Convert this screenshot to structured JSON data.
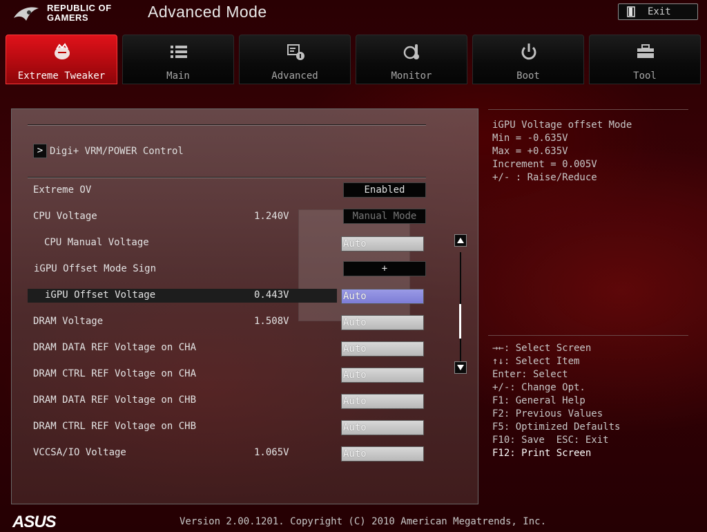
{
  "header": {
    "brand_line1": "REPUBLIC OF",
    "brand_line2": "GAMERS",
    "title": "Advanced Mode",
    "exit_label": "Exit"
  },
  "tabs": [
    {
      "label": "Extreme Tweaker",
      "icon": "extreme-tweaker-icon",
      "active": true
    },
    {
      "label": "Main",
      "icon": "list-icon",
      "active": false
    },
    {
      "label": "Advanced",
      "icon": "settings-monitor-icon",
      "active": false
    },
    {
      "label": "Monitor",
      "icon": "thermometer-icon",
      "active": false
    },
    {
      "label": "Boot",
      "icon": "power-icon",
      "active": false
    },
    {
      "label": "Tool",
      "icon": "toolbox-icon",
      "active": false
    }
  ],
  "submenu": {
    "label": "Digi+ VRM/POWER Control"
  },
  "settings": [
    {
      "label": "Extreme OV",
      "value": "",
      "control": "Enabled"
    },
    {
      "label": "CPU Voltage",
      "value": "1.240V",
      "control": "Manual Mode"
    },
    {
      "label": "CPU Manual Voltage",
      "value": "",
      "control": "Auto"
    },
    {
      "label": "iGPU Offset Mode Sign",
      "value": "",
      "control": "+"
    },
    {
      "label": "iGPU Offset Voltage",
      "value": "0.443V",
      "control": "Auto"
    },
    {
      "label": "DRAM Voltage",
      "value": "1.508V",
      "control": "Auto"
    },
    {
      "label": "DRAM DATA REF Voltage on CHA",
      "value": "",
      "control": "Auto"
    },
    {
      "label": "DRAM CTRL REF Voltage on CHA",
      "value": "",
      "control": "Auto"
    },
    {
      "label": "DRAM DATA REF Voltage on CHB",
      "value": "",
      "control": "Auto"
    },
    {
      "label": "DRAM CTRL REF Voltage on CHB",
      "value": "",
      "control": "Auto"
    },
    {
      "label": "VCCSA/IO Voltage",
      "value": "1.065V",
      "control": "Auto"
    }
  ],
  "help": {
    "lines": [
      "iGPU Voltage offset Mode",
      "Min = -0.635V",
      "Max = +0.635V",
      "Increment = 0.005V",
      "+/- : Raise/Reduce"
    ],
    "keys": [
      "→←: Select Screen",
      "↑↓: Select Item",
      "Enter: Select",
      "+/-: Change Opt.",
      "F1: General Help",
      "F2: Previous Values",
      "F5: Optimized Defaults",
      "F10: Save  ESC: Exit",
      "F12: Print Screen"
    ]
  },
  "footer": {
    "logo": "ASUS",
    "version": "Version 2.00.1201. Copyright (C) 2010 American Megatrends, Inc."
  },
  "colors": {
    "accent": "#d80c14",
    "selected_field": "#8a8ae0",
    "background": "#2a0003"
  }
}
